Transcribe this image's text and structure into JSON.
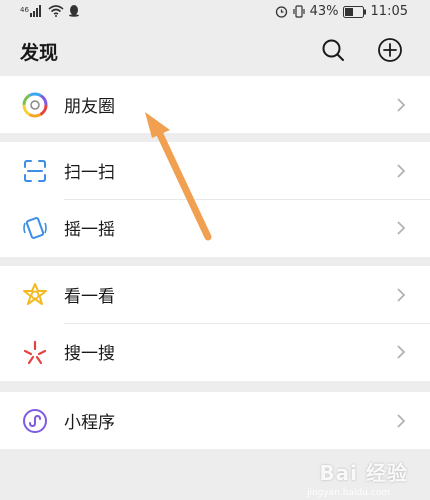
{
  "statusbar": {
    "battery": "43%",
    "time": "11:05"
  },
  "header": {
    "title": "发现",
    "search_icon": "search-icon",
    "add_icon": "plus-circle-icon"
  },
  "sections": [
    {
      "items": [
        {
          "label": "朋友圈",
          "icon": "moments-aperture-icon"
        }
      ]
    },
    {
      "items": [
        {
          "label": "扫一扫",
          "icon": "scan-icon"
        },
        {
          "label": "摇一摇",
          "icon": "shake-icon"
        }
      ]
    },
    {
      "items": [
        {
          "label": "看一看",
          "icon": "top-stories-icon"
        },
        {
          "label": "搜一搜",
          "icon": "search-sparkle-icon"
        }
      ]
    },
    {
      "items": [
        {
          "label": "小程序",
          "icon": "mini-program-icon"
        }
      ]
    }
  ],
  "colors": {
    "background": "#ededed",
    "annotation_arrow": "#f0a050"
  },
  "watermark": {
    "text": "Bai 经验",
    "sub": "jingyan.baidu.com"
  }
}
